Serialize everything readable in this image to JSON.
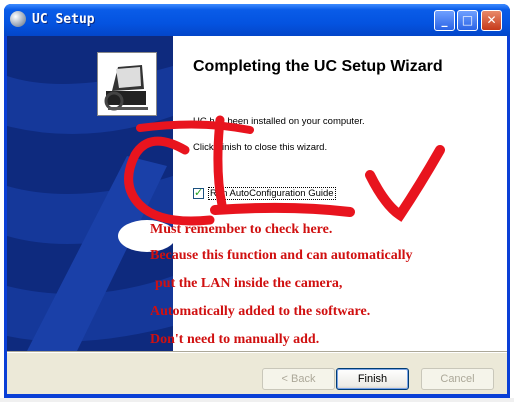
{
  "window": {
    "title": "UC Setup",
    "buttons": {
      "minimize": "_",
      "maximize": "□",
      "close": "✕"
    }
  },
  "wizard": {
    "heading": "Completing the UC Setup Wizard",
    "installed_text": "UC has been installed on your computer.",
    "finish_text": "Click Finish to close this wizard.",
    "checkbox_label": "Run AutoConfiguration Guide",
    "checkbox_checked": true
  },
  "buttons": {
    "back": "< Back",
    "finish": "Finish",
    "cancel": "Cancel"
  },
  "annotations": [
    "Must remember to check here.",
    "Because this function and can automatically",
    "put the LAN inside the camera,",
    "Automatically added to the software.",
    "Don't need to manually add."
  ],
  "colors": {
    "annotation": "#d01010",
    "titlebar": "#0453e0",
    "sidepanel": "#0e2a7e"
  }
}
